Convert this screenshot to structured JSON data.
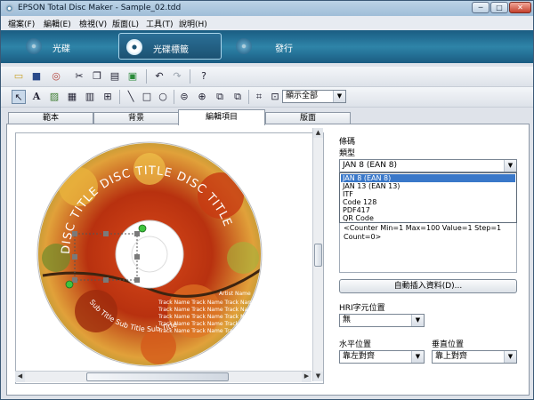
{
  "window": {
    "title": "EPSON Total Disc Maker - Sample_02.tdd",
    "btn_min": "─",
    "btn_max": "□",
    "btn_close": "✕"
  },
  "menu": [
    "檔案(F)",
    "編輯(E)",
    "檢視(V)",
    "版面(L)",
    "工具(T)",
    "說明(H)"
  ],
  "modes": [
    "光碟",
    "光碟標籤",
    "發行"
  ],
  "draw_toolbar": {
    "display_select": "顯示全部"
  },
  "tabs": [
    "範本",
    "背景",
    "編輯項目",
    "版面"
  ],
  "disc_text": {
    "curve_title": "DISC TITLE DISC TITLE DISC TITLE",
    "curve_subtitle": "Sub Title Sub Title Sub Title",
    "list_lines": [
      "Track Name Track Name Track Name",
      "Track Name Track Name Track Name",
      "Track Name Track Name Track Name",
      "Track Name Track Name Track Name",
      "Track Name Track Name Track Name"
    ],
    "artist": "Artist Name"
  },
  "panel": {
    "barcode_heading": "條碼",
    "type_label": "類型",
    "type_value": "JAN 8 (EAN 8)",
    "type_options": [
      "JAN 8 (EAN 8)",
      "JAN 13 (EAN 13)",
      "ITF",
      "Code 128",
      "PDF417",
      "QR Code"
    ],
    "counter_text": "<Counter Min=1 Max=100 Value=1 Step=1 Count=0>",
    "auto_insert_button": "自動插入資料(D)...",
    "hri_label": "HRI字元位置",
    "hri_value": "無",
    "h_align_label": "水平位置",
    "h_align_value": "靠左對齊",
    "v_align_label": "垂直位置",
    "v_align_value": "靠上對齊"
  },
  "colors": {
    "accent": "#2e84a8",
    "selection": "#3a78c9",
    "handle": "#7a7a7a",
    "handle_green": "#3ec43e"
  }
}
